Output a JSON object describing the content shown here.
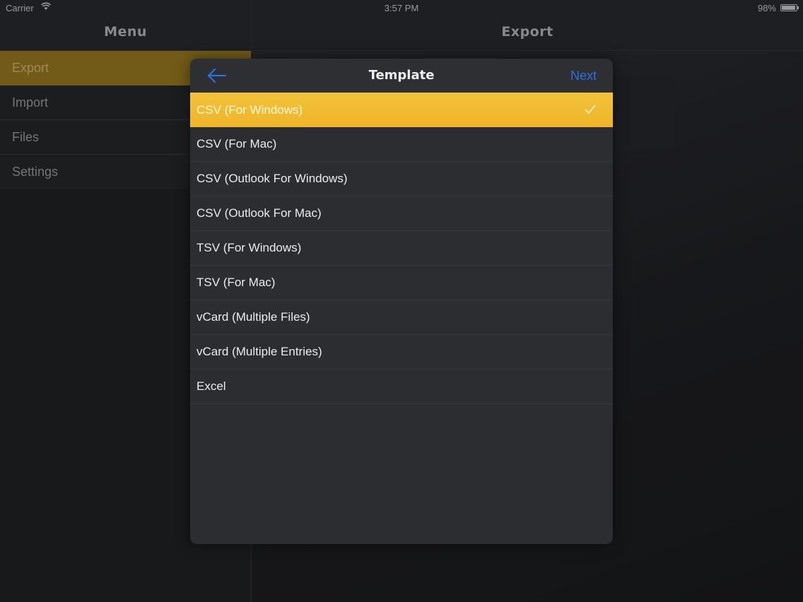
{
  "status_bar": {
    "carrier": "Carrier",
    "time": "3:57 PM",
    "battery": "98%"
  },
  "sidebar": {
    "title": "Menu",
    "items": [
      {
        "label": "Export",
        "selected": true
      },
      {
        "label": "Import"
      },
      {
        "label": "Files"
      },
      {
        "label": "Settings"
      }
    ]
  },
  "detail": {
    "title": "Export"
  },
  "sheet": {
    "title": "Template",
    "back_icon": "arrow-left-icon",
    "next_label": "Next",
    "selected_index": 0,
    "templates": [
      {
        "label": "CSV (For Windows)"
      },
      {
        "label": "CSV (For Mac)"
      },
      {
        "label": "CSV (Outlook For Windows)"
      },
      {
        "label": "CSV (Outlook For Mac)"
      },
      {
        "label": "TSV (For Windows)"
      },
      {
        "label": "TSV (For Mac)"
      },
      {
        "label": "vCard (Multiple Files)"
      },
      {
        "label": "vCard (Multiple Entries)"
      },
      {
        "label": "Excel"
      }
    ]
  },
  "colors": {
    "accent": "#f0bc34",
    "link": "#2f6fe0",
    "sidebar_selected": "#8b6f1e"
  }
}
